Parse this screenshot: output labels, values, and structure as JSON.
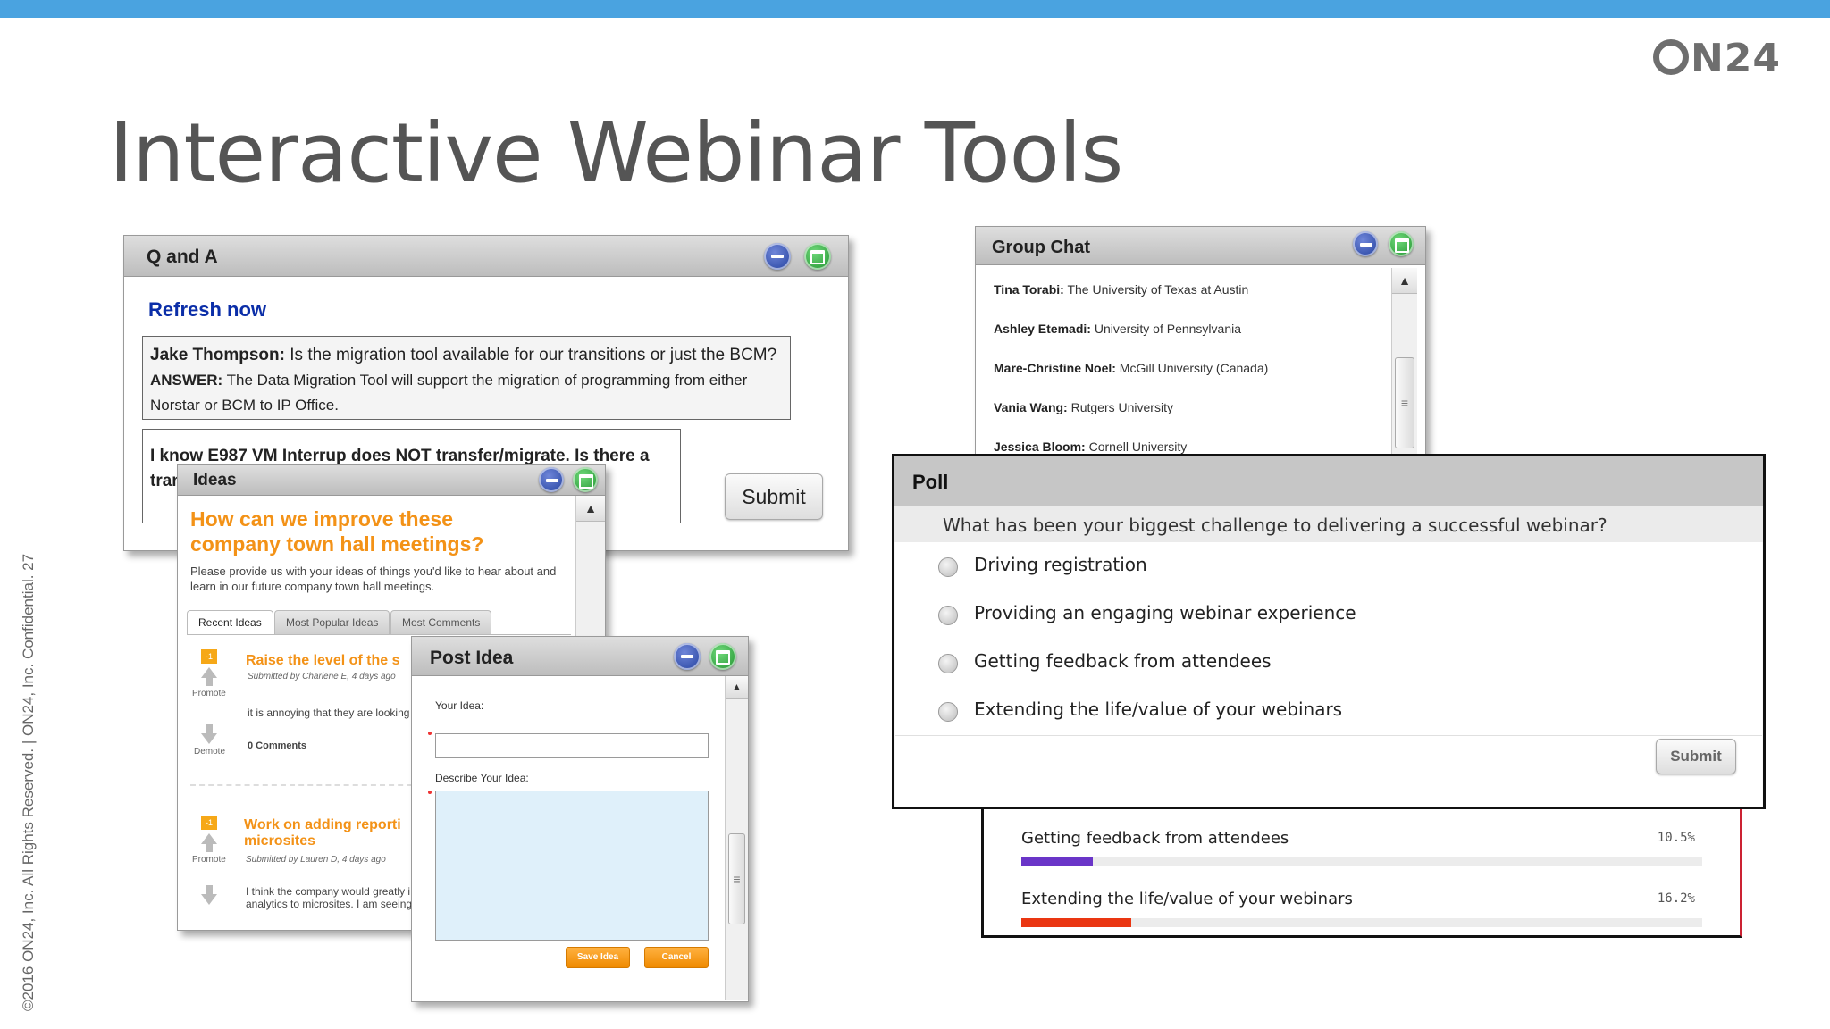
{
  "slide": {
    "title": "Interactive Webinar Tools",
    "logo": "N24",
    "footer": "©2016 ON24, Inc. All Rights Reserved.   |   ON24, Inc. Confidential. 27"
  },
  "qa": {
    "title": "Q and A",
    "refresh": "Refresh now",
    "entry_author": "Jake Thompson:",
    "entry_question": " Is the migration tool available for our transitions or just the BCM?",
    "answer_label": "ANSWER:",
    "answer_text": " The Data Migration Tool will support the migration of programming from either Norstar or BCM to IP Office.",
    "input_value": "I know E987 VM Interrup does NOT transfer/migrate. Is there a tran",
    "submit": "Submit"
  },
  "ideas": {
    "title": "Ideas",
    "headline": "How can we improve these company town hall meetings?",
    "intro": "Please provide us with your ideas of things you'd like to hear about and learn in our future company town hall meetings.",
    "tabs": [
      "Recent Ideas",
      "Most Popular Ideas",
      "Most Comments"
    ],
    "items": [
      {
        "vote": "-1",
        "promote": "Promote",
        "demote": "Demote",
        "title": "Raise the level of the s",
        "meta": "Submitted by Charlene E, 4 days ago",
        "body": "it is annoying that they are looking",
        "comments": "0 Comments"
      },
      {
        "vote": "-1",
        "promote": "Promote",
        "title": "Work on adding reporti microsites",
        "meta": "Submitted by Lauren D, 4 days ago",
        "body": "I think the company would greatly i analytics to microsites. I am seeing"
      }
    ]
  },
  "post_idea": {
    "title": "Post Idea",
    "your_idea_label": "Your Idea:",
    "describe_label": "Describe Your Idea:",
    "save": "Save Idea",
    "cancel": "Cancel"
  },
  "chat": {
    "title": "Group Chat",
    "messages": [
      {
        "name": "Tina Torabi:",
        "text": " The University of Texas at Austin"
      },
      {
        "name": "Ashley Etemadi:",
        "text": " University of Pennsylvania"
      },
      {
        "name": "Mare-Christine Noel:",
        "text": " McGill University (Canada)"
      },
      {
        "name": "Vania Wang:",
        "text": " Rutgers University"
      },
      {
        "name": "Jessica Bloom:",
        "text": " Cornell University"
      }
    ]
  },
  "poll": {
    "title": "Poll",
    "question": "What has been your biggest challenge to delivering a successful webinar?",
    "options": [
      "Driving registration",
      "Providing an engaging webinar experience",
      "Getting feedback from attendees",
      "Extending the life/value of your webinars"
    ],
    "submit": "Submit"
  },
  "results": {
    "rows": [
      {
        "label": "Getting feedback from attendees",
        "pct_text": "10.5%",
        "value": 10.5,
        "color": "#6a35c8"
      },
      {
        "label": "Extending the life/value of your webinars",
        "pct_text": "16.2%",
        "value": 16.2,
        "color": "#ea3612"
      }
    ]
  }
}
